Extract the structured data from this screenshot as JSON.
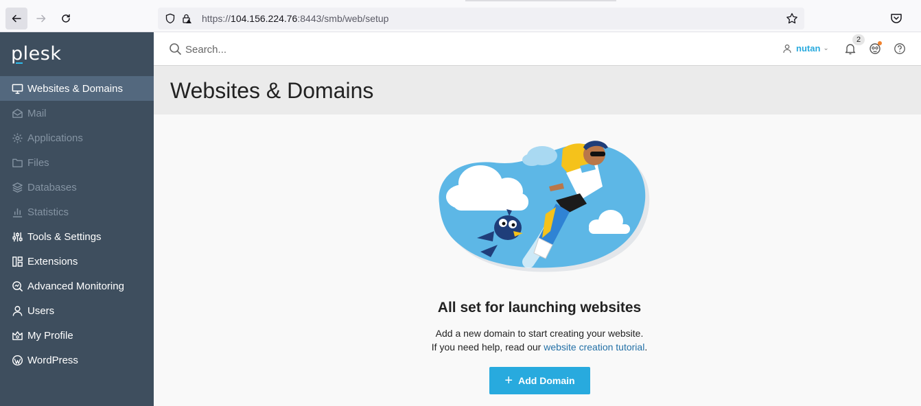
{
  "browser": {
    "url_prefix": "https://",
    "url_host": "104.156.224.76",
    "url_rest": ":8443/smb/web/setup"
  },
  "sidebar": {
    "logo": "plesk",
    "items": [
      {
        "label": "Websites & Domains",
        "icon": "monitor-icon",
        "state": "active"
      },
      {
        "label": "Mail",
        "icon": "mail-icon",
        "state": "disabled"
      },
      {
        "label": "Applications",
        "icon": "gear-icon",
        "state": "disabled"
      },
      {
        "label": "Files",
        "icon": "folder-icon",
        "state": "disabled"
      },
      {
        "label": "Databases",
        "icon": "database-icon",
        "state": "disabled"
      },
      {
        "label": "Statistics",
        "icon": "bar-chart-icon",
        "state": "disabled"
      },
      {
        "label": "Tools & Settings",
        "icon": "sliders-icon",
        "state": "normal"
      },
      {
        "label": "Extensions",
        "icon": "extensions-icon",
        "state": "normal"
      },
      {
        "label": "Advanced Monitoring",
        "icon": "monitoring-icon",
        "state": "normal"
      },
      {
        "label": "Users",
        "icon": "user-icon",
        "state": "normal"
      },
      {
        "label": "My Profile",
        "icon": "crown-icon",
        "state": "normal"
      },
      {
        "label": "WordPress",
        "icon": "wordpress-icon",
        "state": "normal"
      }
    ]
  },
  "header": {
    "search_placeholder": "Search...",
    "username": "nutan",
    "notification_count": "2"
  },
  "page": {
    "title": "Websites & Domains"
  },
  "empty_state": {
    "heading": "All set for launching websites",
    "line1": "Add a new domain to start creating your website.",
    "line2_prefix": "If you need help, read our ",
    "link_text": "website creation tutorial",
    "line2_suffix": ".",
    "button_label": "Add Domain"
  },
  "colors": {
    "sidebar_bg": "#3e4e5e",
    "sidebar_active": "#53687e",
    "accent": "#28aade",
    "link": "#2370a6"
  }
}
